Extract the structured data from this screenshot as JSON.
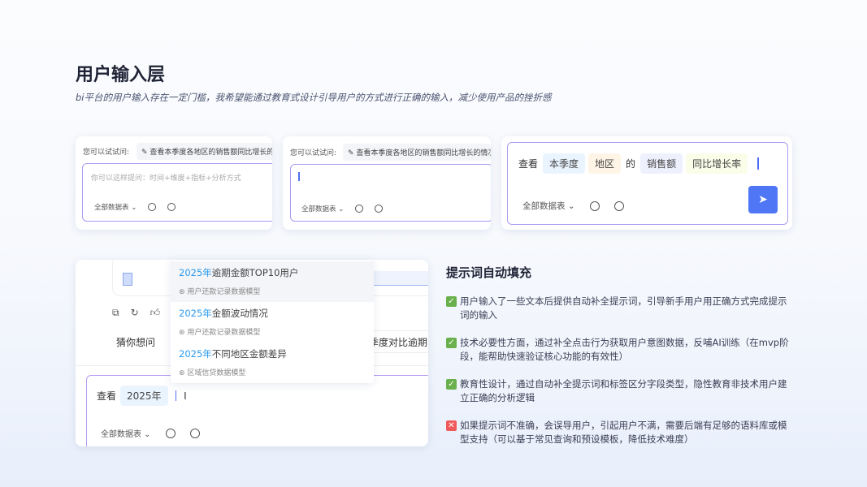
{
  "header": {
    "title": "用户输入层",
    "subtitle": "bi平台的用户输入存在一定门槛，我希望能通过教育式设计引导用户的方式进行正确的输入，减少使用产品的挫折感"
  },
  "card1": {
    "try_label": "您可以试试问:",
    "suggestion": "查看本季度各地区的销售额同比增长的情况",
    "placeholder": "你可以这样提问：时间+维度+指标+分析方式",
    "datasource": "全部数据表"
  },
  "card2": {
    "try_label": "您可以试试问:",
    "suggestion": "查看本季度各地区的销售额同比增长的情况",
    "datasource": "全部数据表"
  },
  "card3": {
    "prefix": "查看",
    "chips": [
      "本季度",
      "地区",
      "的",
      "销售额",
      "同比增长率"
    ],
    "datasource": "全部数据表"
  },
  "bottom": {
    "guess_label": "猜你想问",
    "guess_chip": "季度对比逾期",
    "prefix": "查看",
    "chip": "2025年",
    "datasource": "全部数据表",
    "dropdown": [
      {
        "hl": "2025年",
        "rest": "逾期金额TOP10用户",
        "model": "用户还款记录数据模型"
      },
      {
        "hl": "2025年",
        "rest": "金额波动情况",
        "model": "用户还款记录数据模型"
      },
      {
        "hl": "2025年",
        "rest": "不同地区金额差异",
        "model": "区域信贷数据模型"
      }
    ]
  },
  "feature": {
    "title": "提示词自动填充",
    "points": [
      {
        "type": "pro",
        "text": "用户输入了一些文本后提供自动补全提示词，引导新手用户用正确方式完成提示词的输入"
      },
      {
        "type": "pro",
        "text": "技术必要性方面，通过补全点击行为获取用户意图数据，反哺AI训练（在mvp阶段，能帮助快速验证核心功能的有效性）"
      },
      {
        "type": "pro",
        "text": "教育性设计，通过自动补全提示词和标签区分字段类型，隐性教育非技术用户建立正确的分析逻辑"
      },
      {
        "type": "con",
        "text": "如果提示词不准确，会误导用户，引起用户不满，需要后端有足够的语料库或模型支持（可以基于常见查询和预设模板，降低技术难度）"
      }
    ]
  },
  "colors": {
    "accent": "#4e76f5",
    "check": "#6ab04c",
    "cross": "#ef5b5b"
  }
}
